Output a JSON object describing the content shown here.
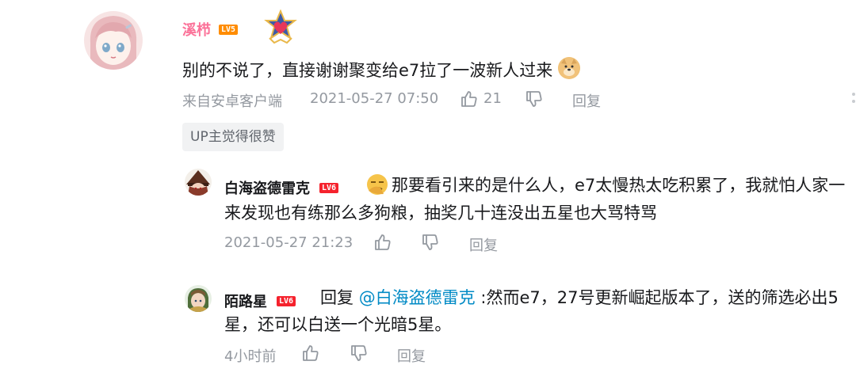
{
  "comment": {
    "username": "溪栉",
    "level": "LV5",
    "text": "别的不说了，直接谢谢聚变给e7拉了一波新人过来",
    "emoji_name": "doge-emoji",
    "source": "来自安卓客户端",
    "time": "2021-05-27 07:50",
    "likes": "21",
    "reply_label": "回复",
    "tag": "UP主觉得很赞",
    "colors": {
      "username": "#fb7299",
      "level": "#ff8c00"
    }
  },
  "replies": [
    {
      "username": "白海盗德雷克",
      "level": "LV6",
      "line1": "那要看引来的是什么人，e7太慢热太吃积累了，我就怕人家一",
      "line2": "来发现也有练那么多狗粮，抽奖几十连没出五星也大骂特骂",
      "time": "2021-05-27 21:23",
      "reply_label": "回复"
    },
    {
      "username": "陌路星",
      "level": "LV6",
      "reply_prefix": "回复",
      "mention": "@白海盗德雷克",
      "line1_rest": ":然而e7，27号更新崛起版本了，送的筛选必出5",
      "line2": "星，还可以白送一个光暗5星。",
      "time": "4小时前",
      "reply_label": "回复"
    }
  ]
}
